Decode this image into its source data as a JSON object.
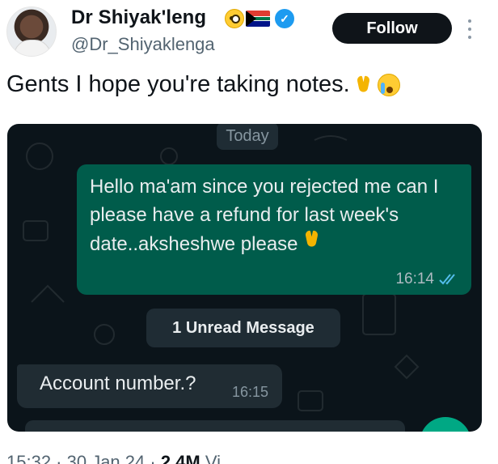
{
  "header": {
    "display_name": "Dr Shiyak'leng",
    "handle": "@Dr_Shiyaklenga",
    "follow_label": "Follow"
  },
  "tweet": {
    "text": "Gents I hope you're taking notes."
  },
  "chat": {
    "date_label": "Today",
    "outgoing": {
      "text": "Hello ma'am since you rejected me can I please have a refund for last week's date..aksheshwe please",
      "time": "16:14"
    },
    "unread_label": "1 Unread Message",
    "incoming": {
      "text": "Account number.?",
      "time": "16:15"
    }
  },
  "footer": {
    "time_partial": "15:32 · 30 Jan 24 ·",
    "views_partial": "2.4M",
    "views_label_partial": "Vi"
  },
  "colors": {
    "verified": "#1d9bf0",
    "chat_background": "#0b141a",
    "outgoing_bubble": "#005c4b",
    "incoming_bubble": "#202c33",
    "read_ticks": "#53bdeb"
  },
  "icons": [
    "face-with-monocle-icon",
    "south-africa-flag-icon",
    "verified-badge-icon",
    "more-icon",
    "folded-hands-icon",
    "crying-face-icon",
    "read-ticks-icon"
  ]
}
